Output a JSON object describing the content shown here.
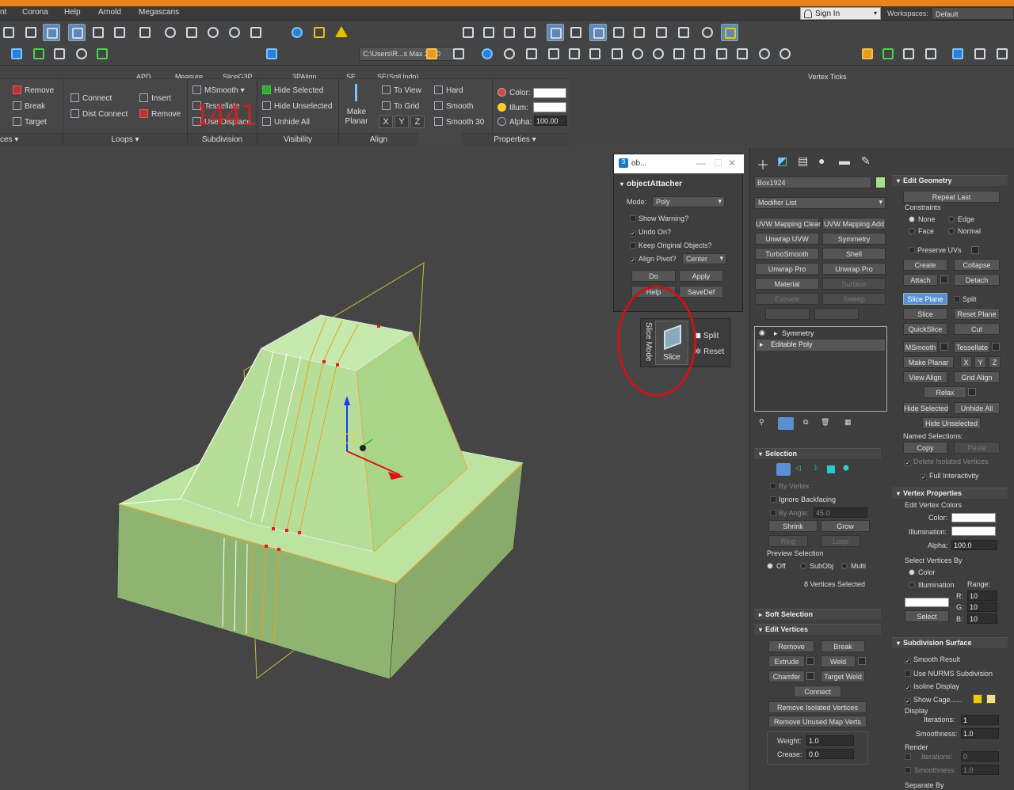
{
  "menu": [
    "nt",
    "Corona",
    "Help",
    "Arnold",
    "Megascans"
  ],
  "signin": "Sign In",
  "workspaces_label": "Workspaces:",
  "workspace_value": "Default",
  "path_box": "C:\\Users\\R...s Max 2020",
  "toolbar_labels": [
    "APD",
    "Measure",
    "SliceG3P",
    "3PAlign",
    "SE",
    "SE(SplUndo)",
    "Vertex Ticks"
  ],
  "ribbon": {
    "col1": [
      "Remove",
      "Break",
      "Target"
    ],
    "col1_foot": "ces ▾",
    "loops_items": [
      "Connect",
      "Dist Connect",
      "Insert",
      "Remove"
    ],
    "loops_foot": "Loops ▾",
    "subdiv_items": [
      "MSmooth",
      "Tessellate",
      "Use Displace"
    ],
    "subdiv_foot": "Subdivision",
    "vis_items": [
      "Hide Selected",
      "Hide Unselected",
      "Unhide All"
    ],
    "vis_foot": "Visibility",
    "make_planar": "Make Planar",
    "align_items": [
      "To View",
      "To Grid"
    ],
    "xyz": [
      "X",
      "Y",
      "Z"
    ],
    "align_foot": "Align",
    "smooth_items": [
      "Hard",
      "Smooth",
      "Smooth 30"
    ],
    "props": [
      "Color:",
      "Illum:",
      "Alpha:"
    ],
    "alpha_value": "100.00",
    "props_foot": "Properties ▾",
    "red_mark": "1441"
  },
  "dialog": {
    "title": "ob...",
    "header": "objectAttacher",
    "mode_label": "Mode:",
    "mode_value": "Poly",
    "show_warning": "Show Warning?",
    "undo_on": "Undo On?",
    "keep_original": "Keep Original Objects?",
    "align_pivot": "Align Pivot?",
    "align_value": "Center",
    "buttons": [
      "Do",
      "Apply",
      "Help",
      "SaveDef"
    ]
  },
  "slice_panel": {
    "mode_label": "Slice Mode",
    "slice": "Slice",
    "split": "Split",
    "reset": "Reset"
  },
  "cmd": {
    "object_name": "Box1924",
    "object_color": "#a8e08a",
    "modifier_list": "Modifier List",
    "modifier_buttons": [
      "UVW Mapping Clear",
      "UVW Mapping Add",
      "Unwrap UVW",
      "Symmetry",
      "TurboSmooth",
      "Shell",
      "Unwrap Pro",
      "Unwrap Pro",
      "Material",
      "Surface",
      "Extrude",
      "Sweep"
    ],
    "stack": [
      "Symmetry",
      "Editable Poly"
    ],
    "selection": {
      "title": "Selection",
      "by_vertex": "By Vertex",
      "ignore_backfacing": "Ignore Backfacing",
      "by_angle": "By Angle:",
      "angle_value": "45.0",
      "shrink": "Shrink",
      "grow": "Grow",
      "ring": "Ring",
      "loop": "Loop",
      "preview": "Preview Selection",
      "preview_opts": [
        "Off",
        "SubObj",
        "Multi"
      ],
      "status": "8 Vertices Selected"
    },
    "soft_selection": "Soft Selection",
    "edit_vertices": {
      "title": "Edit Vertices",
      "buttons": [
        "Remove",
        "Break",
        "Extrude",
        "Weld",
        "Chamfer",
        "Target Weld",
        "Connect",
        "Remove Isolated Vertices",
        "Remove Unused Map Verts"
      ],
      "weight_label": "Weight:",
      "weight": "1.0",
      "crease_label": "Crease:",
      "crease": "0.0"
    },
    "edit_geometry": {
      "title": "Edit Geometry",
      "repeat_last": "Repeat Last",
      "constraints": "Constraints",
      "constraint_opts": [
        "None",
        "Edge",
        "Face",
        "Normal"
      ],
      "preserve_uvs": "Preserve UVs",
      "buttons": [
        "Create",
        "Collapse",
        "Attach",
        "Detach",
        "Slice Plane",
        "Split",
        "Slice",
        "Reset Plane",
        "QuickSlice",
        "Cut",
        "MSmooth",
        "Tessellate",
        "Make Planar",
        "X",
        "Y",
        "Z",
        "View Align",
        "Grid Align",
        "Relax",
        "Hide Selected",
        "Unhide All",
        "Hide Unselected",
        "Copy",
        "Paste"
      ],
      "named_selections": "Named Selections:",
      "delete_isolated": "Delete Isolated Vertices",
      "full_interactivity": "Full Interactivity"
    },
    "vertex_props": {
      "title": "Vertex Properties",
      "edit_colors": "Edit Vertex Colors",
      "color": "Color:",
      "illumination": "Illumination:",
      "alpha": "Alpha:",
      "alpha_value": "100.0",
      "select_by": "Select Vertices By",
      "opt_color": "Color",
      "opt_illum": "Illumination",
      "range": "Range:",
      "r": "R:",
      "g": "G:",
      "b": "B:",
      "r_val": "10",
      "g_val": "10",
      "b_val": "10",
      "select": "Select"
    },
    "subdiv_surface": {
      "title": "Subdivision Surface",
      "smooth_result": "Smooth Result",
      "use_nurms": "Use NURMS Subdivision",
      "isoline": "Isoline Display",
      "show_cage": "Show Cage......",
      "display": "Display",
      "iterations": "Iterations:",
      "iter_val": "1",
      "smoothness": "Smoothness:",
      "smooth_val": "1.0",
      "render": "Render",
      "r_iter_val": "0",
      "r_smooth_val": "1.0",
      "separate_by": "Separate By"
    }
  }
}
